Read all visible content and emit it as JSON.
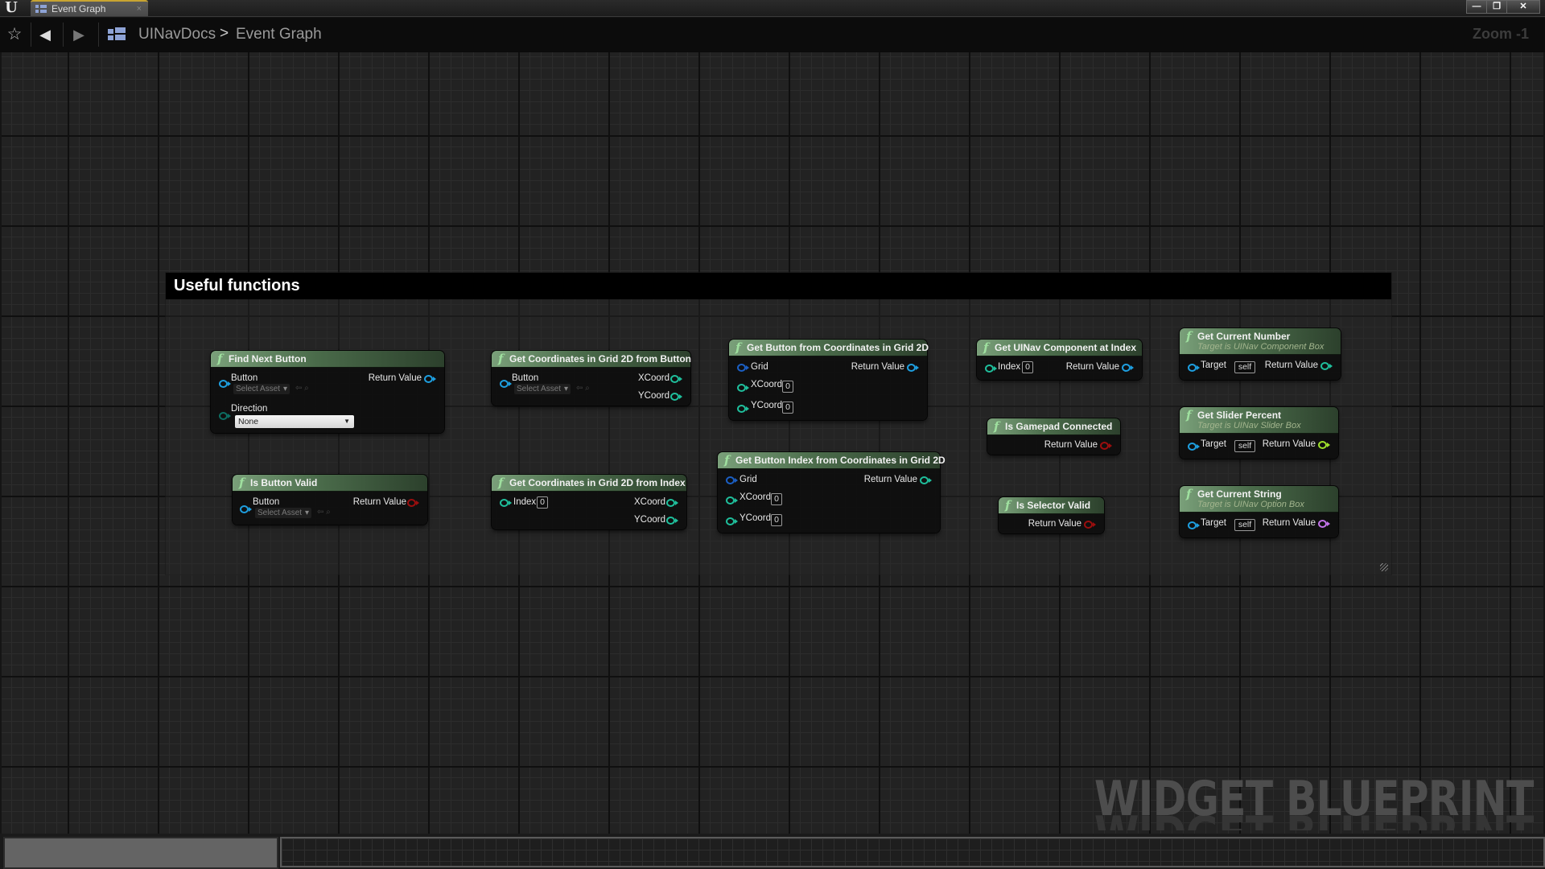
{
  "window": {
    "tab_title": "Event Graph",
    "tab_close": "×",
    "controls": {
      "minimize": "—",
      "restore": "❐",
      "close": "✕"
    }
  },
  "toolbar": {
    "favorite_icon": "☆",
    "back_icon": "◀",
    "forward_icon": "▶",
    "breadcrumb": [
      "UINavDocs",
      "Event Graph"
    ],
    "breadcrumb_sep": ">",
    "zoom_label": "Zoom -1"
  },
  "comment": {
    "title": "Useful functions"
  },
  "nodes": {
    "find_next_button": {
      "title": "Find Next Button",
      "inputs": [
        {
          "label": "Button",
          "widget": "Select Asset"
        },
        {
          "label": "Direction",
          "value": "None"
        }
      ],
      "outputs": [
        {
          "label": "Return Value"
        }
      ]
    },
    "is_button_valid": {
      "title": "Is Button Valid",
      "inputs": [
        {
          "label": "Button",
          "widget": "Select Asset"
        }
      ],
      "outputs": [
        {
          "label": "Return Value"
        }
      ]
    },
    "get_coords_from_button": {
      "title": "Get Coordinates in Grid 2D from Button",
      "inputs": [
        {
          "label": "Button",
          "widget": "Select Asset"
        }
      ],
      "outputs": [
        {
          "label": "XCoord"
        },
        {
          "label": "YCoord"
        }
      ]
    },
    "get_coords_from_index": {
      "title": "Get Coordinates in Grid 2D from Index",
      "inputs": [
        {
          "label": "Index",
          "value": "0"
        }
      ],
      "outputs": [
        {
          "label": "XCoord"
        },
        {
          "label": "YCoord"
        }
      ]
    },
    "get_button_from_coords": {
      "title": "Get Button from Coordinates in Grid 2D",
      "inputs": [
        {
          "label": "Grid"
        },
        {
          "label": "XCoord",
          "value": "0"
        },
        {
          "label": "YCoord",
          "value": "0"
        }
      ],
      "outputs": [
        {
          "label": "Return Value"
        }
      ]
    },
    "get_button_index_from_coords": {
      "title": "Get Button Index from Coordinates in Grid 2D",
      "inputs": [
        {
          "label": "Grid"
        },
        {
          "label": "XCoord",
          "value": "0"
        },
        {
          "label": "YCoord",
          "value": "0"
        }
      ],
      "outputs": [
        {
          "label": "Return Value"
        }
      ]
    },
    "get_uinav_component_at_index": {
      "title": "Get UINav Component at Index",
      "inputs": [
        {
          "label": "Index",
          "value": "0"
        }
      ],
      "outputs": [
        {
          "label": "Return Value"
        }
      ]
    },
    "is_gamepad_connected": {
      "title": "Is Gamepad Connected",
      "outputs": [
        {
          "label": "Return Value"
        }
      ]
    },
    "is_selector_valid": {
      "title": "Is Selector Valid",
      "outputs": [
        {
          "label": "Return Value"
        }
      ]
    },
    "get_current_number": {
      "title": "Get Current Number",
      "subtitle": "Target is UINav Component Box",
      "inputs": [
        {
          "label": "Target",
          "value": "self"
        }
      ],
      "outputs": [
        {
          "label": "Return Value"
        }
      ]
    },
    "get_slider_percent": {
      "title": "Get Slider Percent",
      "subtitle": "Target is UINav Slider Box",
      "inputs": [
        {
          "label": "Target",
          "value": "self"
        }
      ],
      "outputs": [
        {
          "label": "Return Value"
        }
      ]
    },
    "get_current_string": {
      "title": "Get Current String",
      "subtitle": "Target is UINav Option Box",
      "inputs": [
        {
          "label": "Target",
          "value": "self"
        }
      ],
      "outputs": [
        {
          "label": "Return Value"
        }
      ]
    }
  },
  "function_glyph": "f",
  "asset_tools": "⇦ ⌕",
  "watermark": "WIDGET BLUEPRINT",
  "pin_colors": {
    "object": "#1e9fe0",
    "integer": "#1fbf9c",
    "boolean": "#9b0e0e",
    "float": "#9ee02c",
    "string": "#c273e8"
  }
}
